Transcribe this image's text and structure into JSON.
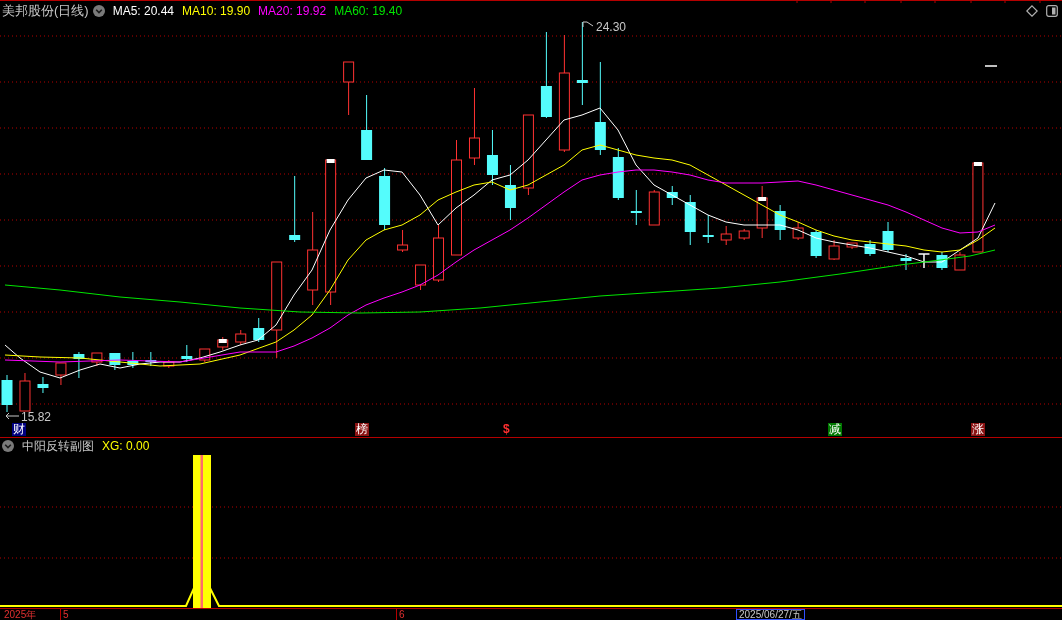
{
  "main_panel": {
    "title": "美邦股份(日线)",
    "indicators": [
      {
        "label": "MA5: 20.44",
        "color": "#ffffff"
      },
      {
        "label": "MA10: 19.90",
        "color": "#ffff00"
      },
      {
        "label": "MA20: 19.92",
        "color": "#ff00ff"
      },
      {
        "label": "MA60: 19.40",
        "color": "#00e600"
      }
    ],
    "high_label": "24.30",
    "low_label": "15.82",
    "signals": [
      {
        "label": "财",
        "kind": "badge",
        "color": "#000080"
      },
      {
        "label": "榜",
        "kind": "badge",
        "color": "#8c1414"
      },
      {
        "label": "$",
        "kind": "glyph",
        "color": "#ff3030"
      },
      {
        "label": "减",
        "kind": "badge",
        "color": "#007800"
      },
      {
        "label": "涨",
        "kind": "badge",
        "color": "#8c1414"
      }
    ]
  },
  "sub_panel": {
    "title": "中阳反转副图",
    "indicators": [
      {
        "label": "XG: 0.00",
        "color": "#ffff00"
      }
    ]
  },
  "time_axis": {
    "labels": [
      "2025年",
      "5",
      "6"
    ],
    "cursor_date": "2025/06/27/五"
  }
}
